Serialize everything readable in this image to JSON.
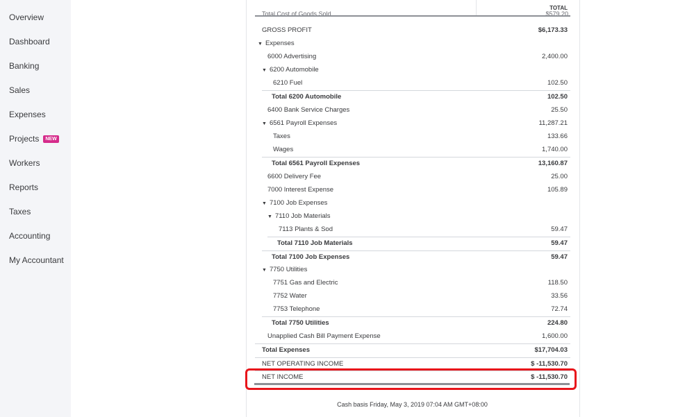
{
  "sidebar": {
    "items": [
      {
        "label": "Overview"
      },
      {
        "label": "Dashboard"
      },
      {
        "label": "Banking"
      },
      {
        "label": "Sales"
      },
      {
        "label": "Expenses"
      },
      {
        "label": "Projects",
        "badge": "NEW"
      },
      {
        "label": "Workers"
      },
      {
        "label": "Reports"
      },
      {
        "label": "Taxes"
      },
      {
        "label": "Accounting"
      },
      {
        "label": "My Accountant"
      }
    ]
  },
  "report": {
    "column_header": "TOTAL",
    "cut_off_label": "Total Cost of Goods Sold",
    "cut_off_value": "$579.20",
    "rows": [
      {
        "label": "GROSS PROFIT",
        "value": "$6,173.33"
      },
      {
        "label": "Expenses",
        "value": ""
      },
      {
        "label": "6000 Advertising",
        "value": "2,400.00"
      },
      {
        "label": "6200 Automobile",
        "value": ""
      },
      {
        "label": "6210 Fuel",
        "value": "102.50"
      },
      {
        "label": "Total 6200 Automobile",
        "value": "102.50"
      },
      {
        "label": "6400 Bank Service Charges",
        "value": "25.50"
      },
      {
        "label": "6561 Payroll Expenses",
        "value": "11,287.21"
      },
      {
        "label": "Taxes",
        "value": "133.66"
      },
      {
        "label": "Wages",
        "value": "1,740.00"
      },
      {
        "label": "Total 6561 Payroll Expenses",
        "value": "13,160.87"
      },
      {
        "label": "6600 Delivery Fee",
        "value": "25.00"
      },
      {
        "label": "7000 Interest Expense",
        "value": "105.89"
      },
      {
        "label": "7100 Job Expenses",
        "value": ""
      },
      {
        "label": "7110 Job Materials",
        "value": ""
      },
      {
        "label": "7113 Plants & Sod",
        "value": "59.47"
      },
      {
        "label": "Total 7110 Job Materials",
        "value": "59.47"
      },
      {
        "label": "Total 7100 Job Expenses",
        "value": "59.47"
      },
      {
        "label": "7750 Utilities",
        "value": ""
      },
      {
        "label": "7751 Gas and Electric",
        "value": "118.50"
      },
      {
        "label": "7752 Water",
        "value": "33.56"
      },
      {
        "label": "7753 Telephone",
        "value": "72.74"
      },
      {
        "label": "Total 7750 Utilities",
        "value": "224.80"
      },
      {
        "label": "Unapplied Cash Bill Payment Expense",
        "value": "1,600.00"
      },
      {
        "label": "Total Expenses",
        "value": "$17,704.03"
      },
      {
        "label": "NET OPERATING INCOME",
        "value": "$ -11,530.70"
      },
      {
        "label": "NET INCOME",
        "value": "$ -11,530.70"
      }
    ],
    "footer": "Cash basis  Friday, May 3, 2019  07:04 AM GMT+08:00"
  },
  "colors": {
    "sidebar_bg": "#f4f5f8",
    "badge": "#d52b8b",
    "highlight": "#e8151b",
    "text": "#393a3d"
  }
}
